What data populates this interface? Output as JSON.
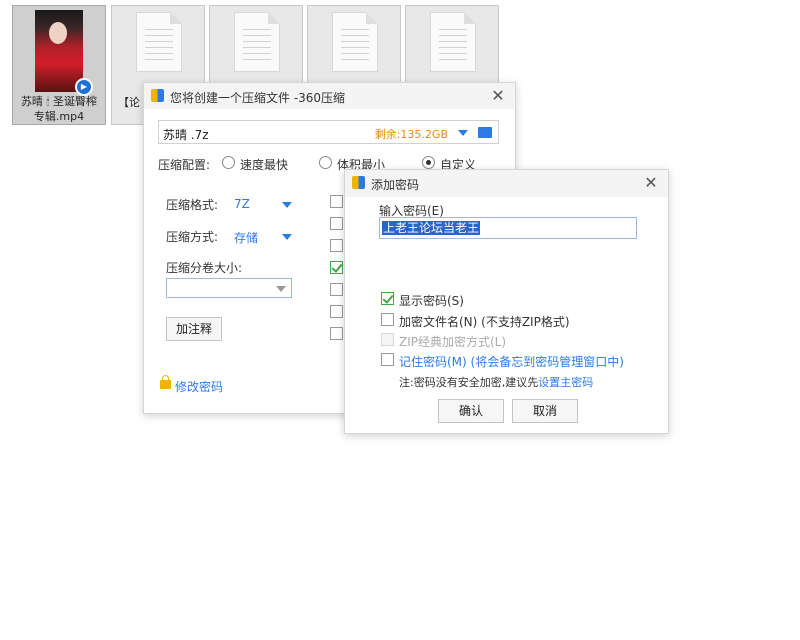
{
  "desktop": {
    "files": [
      {
        "name_line1": "苏晴 🕯 圣诞臀榨",
        "name_line2": "专辑.mp4",
        "type": "video"
      },
      {
        "name": "【论",
        "type": "document"
      },
      {
        "name": "",
        "type": "document"
      },
      {
        "name": "",
        "type": "document"
      },
      {
        "name": "",
        "type": "document"
      }
    ]
  },
  "compress_dialog": {
    "title": "您将创建一个压缩文件 -360压缩",
    "path": "苏晴 .7z",
    "free_space": "剩余:135.2GB",
    "config_label": "压缩配置:",
    "options": [
      "速度最快",
      "体积最小",
      "自定义"
    ],
    "selected_option": "自定义",
    "format_label": "压缩格式:",
    "format_value": "7Z",
    "method_label": "压缩方式:",
    "method_value": "存储",
    "split_label": "压缩分卷大小:",
    "split_value": "",
    "comment_button": "加注释",
    "change_password_link": "修改密码",
    "side_checkboxes": [
      false,
      false,
      false,
      true,
      false,
      false,
      false
    ]
  },
  "password_dialog": {
    "title": "添加密码",
    "input_label": "输入密码(E)",
    "password_value": "上老王论坛当老王",
    "show_password": {
      "label": "显示密码(S)",
      "checked": true
    },
    "encrypt_filenames": {
      "label": "加密文件名(N) (不支持ZIP格式)",
      "checked": false
    },
    "zip_classic": {
      "label": "ZIP经典加密方式(L)",
      "checked": false,
      "disabled": true
    },
    "remember_password": {
      "label": "记住密码(M) (将会备忘到密码管理窗口中)",
      "checked": false
    },
    "note_prefix": "注:密码没有安全加密,建议先",
    "note_link": "设置主密码",
    "ok_button": "确认",
    "cancel_button": "取消"
  },
  "colors": {
    "accent": "#2c7be5",
    "free_space": "#f08a00",
    "check": "#45a64a"
  }
}
